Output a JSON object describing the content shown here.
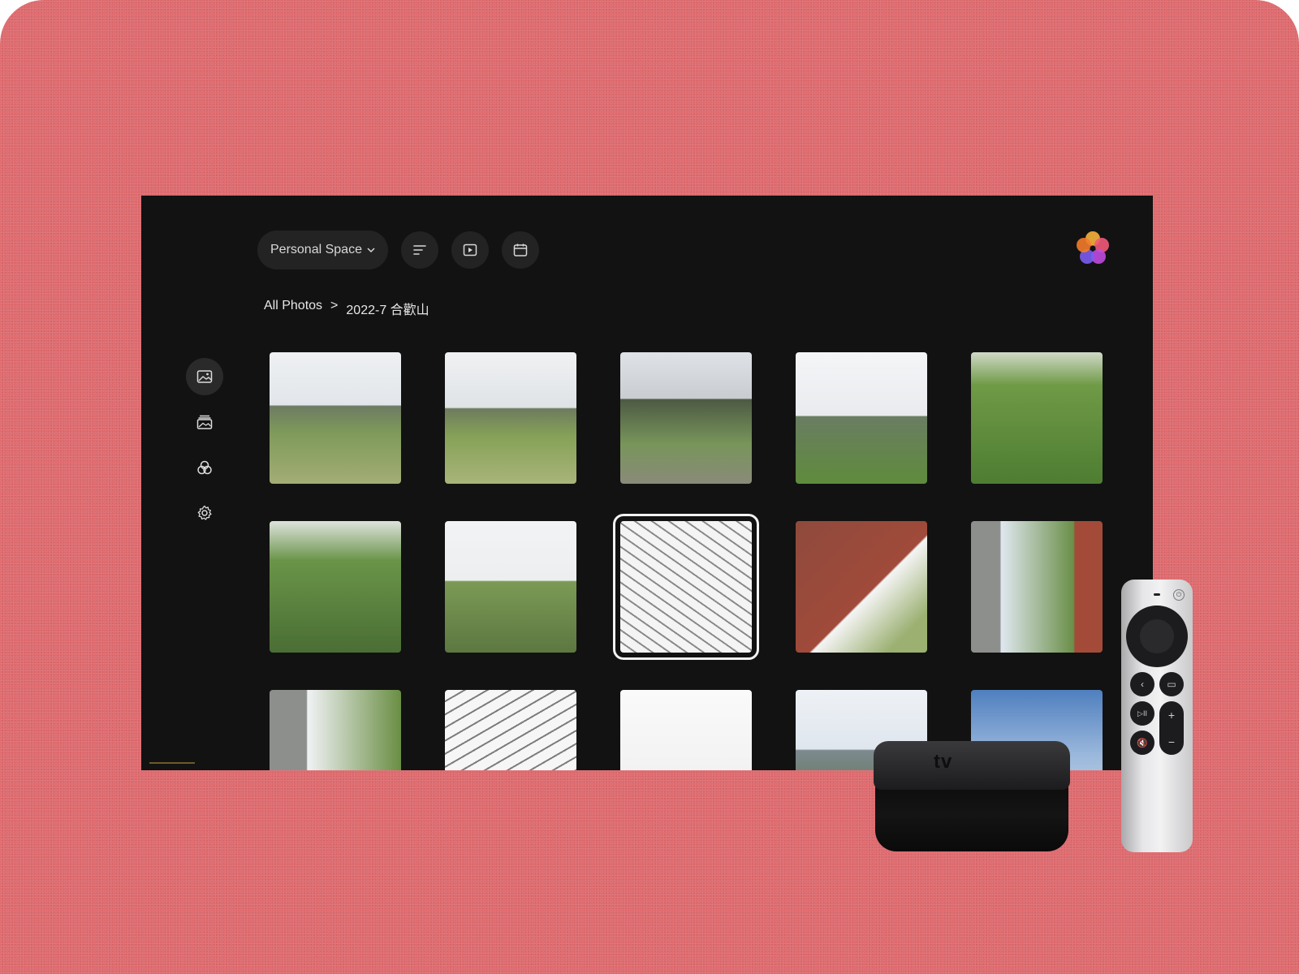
{
  "header": {
    "space_label": "Personal Space",
    "sort_icon": "sort-icon",
    "slideshow_icon": "slideshow-icon",
    "calendar_icon": "calendar-icon",
    "logo_icon": "flower-logo-icon"
  },
  "breadcrumb": {
    "root": "All Photos",
    "separator": ">",
    "current": "2022-7 合歡山"
  },
  "sidebar": {
    "items": [
      {
        "icon": "photos-icon",
        "active": true
      },
      {
        "icon": "albums-icon",
        "active": false
      },
      {
        "icon": "people-icon",
        "active": false
      },
      {
        "icon": "settings-icon",
        "active": false
      }
    ]
  },
  "grid": {
    "focused_index": 7,
    "tiles": 15
  },
  "devices": {
    "box_mark": "tv",
    "remote": {
      "vol_up": "+",
      "vol_down": "−",
      "play_pause": "▷II",
      "back": "‹",
      "tv": "▭",
      "mute": "🔇"
    }
  },
  "colors": {
    "backdrop": "#df6b6f",
    "screen": "#121212",
    "control": "#232323",
    "focus_ring": "#f2f2f2"
  }
}
